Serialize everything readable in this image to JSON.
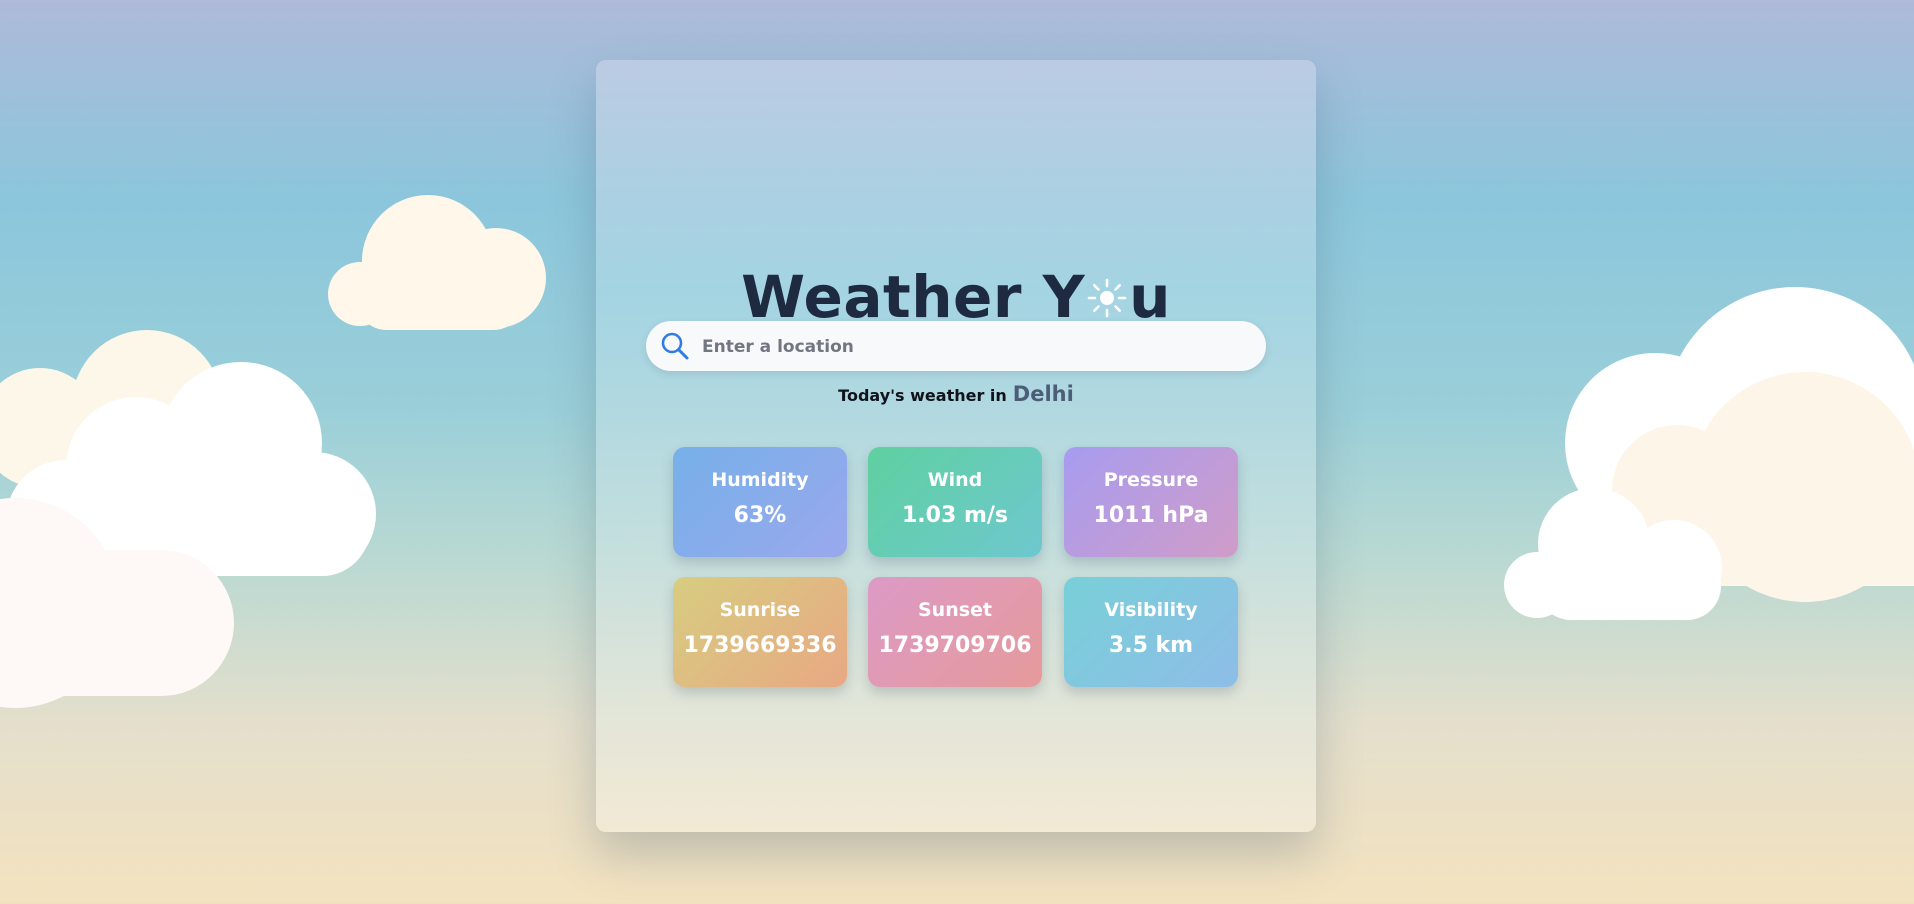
{
  "app": {
    "title_before": "Weather Y",
    "title_after": "u",
    "title_icon": "sun-icon"
  },
  "search": {
    "placeholder": "Enter a location",
    "value": "",
    "icon": "search-icon"
  },
  "today": {
    "label": "Today's weather in",
    "city": "Delhi"
  },
  "stats": [
    {
      "label": "Humidity",
      "value": "63%"
    },
    {
      "label": "Wind",
      "value": "1.03 m/s"
    },
    {
      "label": "Pressure",
      "value": "1011 hPa"
    },
    {
      "label": "Sunrise",
      "value": "1739669336"
    },
    {
      "label": "Sunset",
      "value": "1739709706"
    },
    {
      "label": "Visibility",
      "value": "3.5 km"
    }
  ],
  "colors": {
    "title": "#1d2a40",
    "city": "#4c5d77",
    "search_icon": "#2f7de0"
  }
}
